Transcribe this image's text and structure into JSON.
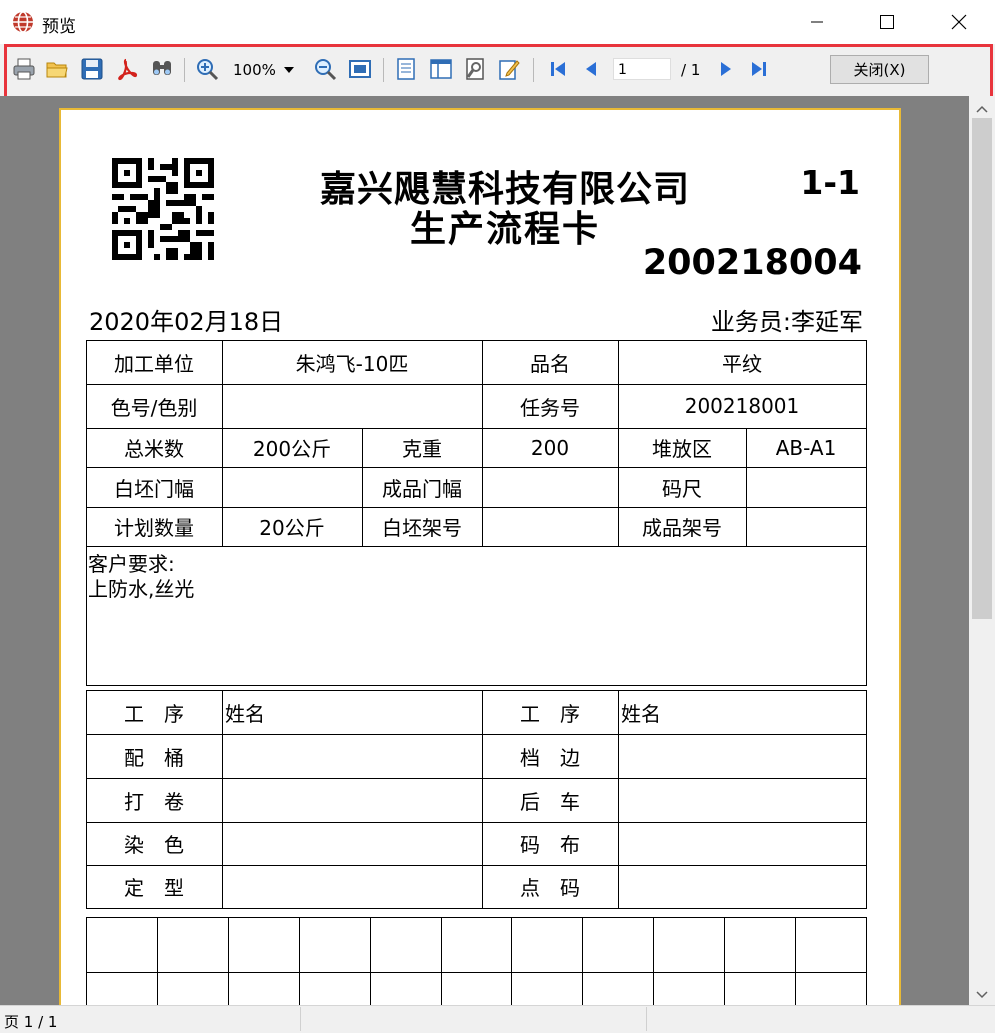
{
  "window": {
    "title": "预览"
  },
  "toolbar": {
    "zoom": "100%",
    "page_current": "1",
    "page_total": "/ 1",
    "close_label": "关闭(X)"
  },
  "status": {
    "pages": "页 1 / 1"
  },
  "doc": {
    "company": "嘉兴飓慧科技有限公司",
    "card_name": "生产流程卡",
    "seq": "1-1",
    "number": "200218004",
    "date": "2020年02月18日",
    "salesperson": "业务员:李延军",
    "info": {
      "r1": [
        "加工单位",
        "朱鸿飞-10匹",
        "品名",
        "平纹"
      ],
      "r2": [
        "色号/色别",
        "",
        "任务号",
        "200218001"
      ],
      "r3": [
        "总米数",
        "200公斤",
        "克重",
        "200",
        "堆放区",
        "AB-A1"
      ],
      "r4": [
        "白坯门幅",
        "",
        "成品门幅",
        "",
        "码尺",
        ""
      ],
      "r5": [
        "计划数量",
        "20公斤",
        "白坯架号",
        "",
        "成品架号",
        ""
      ]
    },
    "requirements_label": "客户要求:",
    "requirements_value": "上防水,丝光",
    "process": {
      "head": [
        "工　序",
        "姓名",
        "工　序",
        "姓名"
      ],
      "rows": [
        [
          "配　桶",
          "档　边"
        ],
        [
          "打　卷",
          "后　车"
        ],
        [
          "染　色",
          "码　布"
        ],
        [
          "定　型",
          "点　码"
        ]
      ]
    }
  },
  "colors": {
    "toolbar_highlight": "#e8343c",
    "paper_border": "#e8b936",
    "viewport": "#808080"
  },
  "icons": [
    "app-globe-icon",
    "minimize-icon",
    "maximize-icon",
    "close-icon",
    "print-icon",
    "open-folder-icon",
    "save-icon",
    "pdf-icon",
    "find-icon",
    "zoom-in-icon",
    "dropdown-arrow-icon",
    "zoom-out-icon",
    "fit-page-icon",
    "single-page-icon",
    "two-page-icon",
    "page-setup-icon",
    "edit-icon",
    "first-page-icon",
    "prev-page-icon",
    "next-page-icon",
    "last-page-icon",
    "qr-code-icon",
    "scroll-up-icon",
    "scroll-down-icon"
  ]
}
